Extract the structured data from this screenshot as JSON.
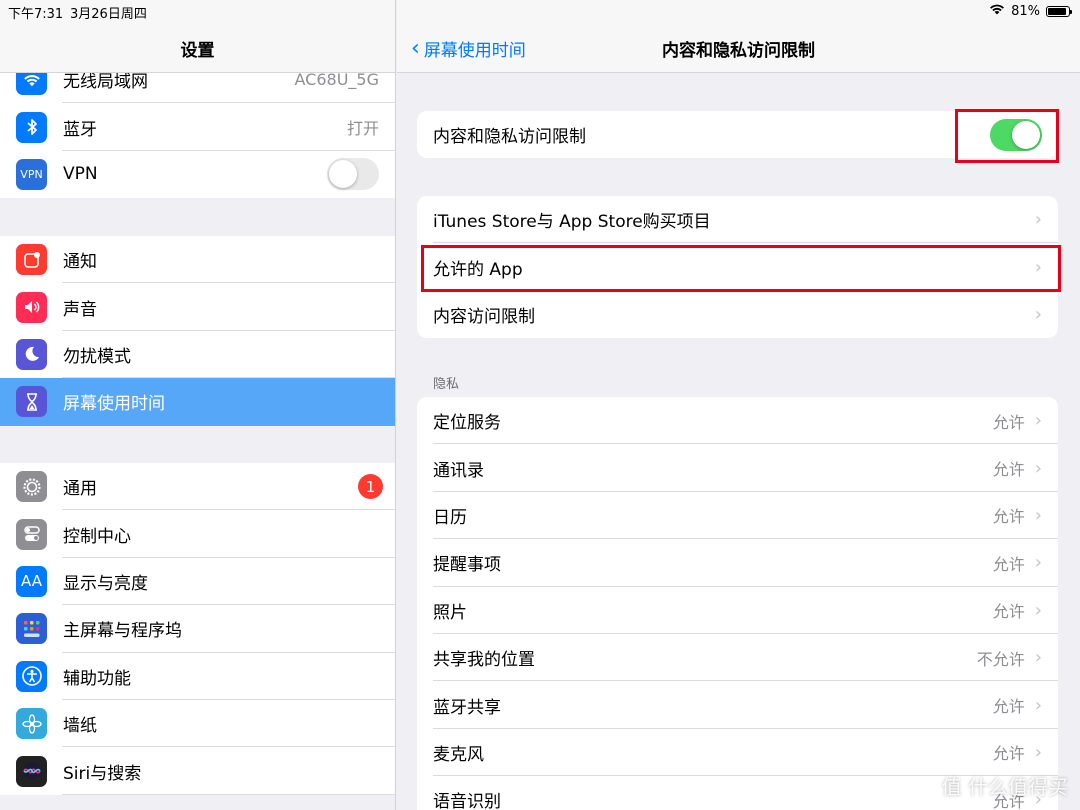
{
  "status": {
    "time": "下午7:31",
    "date": "3月26日周四",
    "battery": "81%"
  },
  "sidebar": {
    "title": "设置",
    "group1": [
      {
        "label": "无线局域网",
        "value": "AC68U_5G",
        "icon": "wifi-icon",
        "color": "#007aff"
      },
      {
        "label": "蓝牙",
        "value": "打开",
        "icon": "bluetooth-icon",
        "color": "#007aff"
      },
      {
        "label": "VPN",
        "icon": "vpn-icon",
        "color": "#2a6fdb",
        "icon_text": "VPN",
        "toggle": false
      }
    ],
    "group2": [
      {
        "label": "通知",
        "icon": "notifications-icon",
        "color": "#ff3b30"
      },
      {
        "label": "声音",
        "icon": "sound-icon",
        "color": "#ff2d55"
      },
      {
        "label": "勿扰模式",
        "icon": "moon-icon",
        "color": "#5856d6"
      },
      {
        "label": "屏幕使用时间",
        "icon": "hourglass-icon",
        "color": "#5856d6",
        "selected": true
      }
    ],
    "group3": [
      {
        "label": "通用",
        "icon": "gear-icon",
        "color": "#8e8e93",
        "badge": "1"
      },
      {
        "label": "控制中心",
        "icon": "control-center-icon",
        "color": "#8e8e93"
      },
      {
        "label": "显示与亮度",
        "icon": "display-icon",
        "color": "#007aff",
        "icon_text": "AA"
      },
      {
        "label": "主屏幕与程序坞",
        "icon": "home-screen-icon",
        "color": "#2c5ed8"
      },
      {
        "label": "辅助功能",
        "icon": "accessibility-icon",
        "color": "#007aff"
      },
      {
        "label": "墙纸",
        "icon": "wallpaper-icon",
        "color": "#34aadc"
      },
      {
        "label": "Siri与搜索",
        "icon": "siri-icon",
        "color": "#222222"
      }
    ]
  },
  "detail": {
    "back_label": "屏幕使用时间",
    "title": "内容和隐私访问限制",
    "toggle_row": {
      "label": "内容和隐私访问限制",
      "on": true
    },
    "card2": [
      {
        "label": "iTunes Store与 App Store购买项目"
      },
      {
        "label": "允许的 App"
      },
      {
        "label": "内容访问限制"
      }
    ],
    "privacy_header": "隐私",
    "privacy": [
      {
        "label": "定位服务",
        "value": "允许"
      },
      {
        "label": "通讯录",
        "value": "允许"
      },
      {
        "label": "日历",
        "value": "允许"
      },
      {
        "label": "提醒事项",
        "value": "允许"
      },
      {
        "label": "照片",
        "value": "允许"
      },
      {
        "label": "共享我的位置",
        "value": "不允许"
      },
      {
        "label": "蓝牙共享",
        "value": "允许"
      },
      {
        "label": "麦克风",
        "value": "允许"
      },
      {
        "label": "语音识别",
        "value": "允许"
      }
    ]
  },
  "watermark": "值 什么值得买",
  "colors": {
    "accent": "#007aff",
    "toggle_on": "#4cd964",
    "selected": "#57a7f9",
    "highlight": "#e6001a"
  }
}
